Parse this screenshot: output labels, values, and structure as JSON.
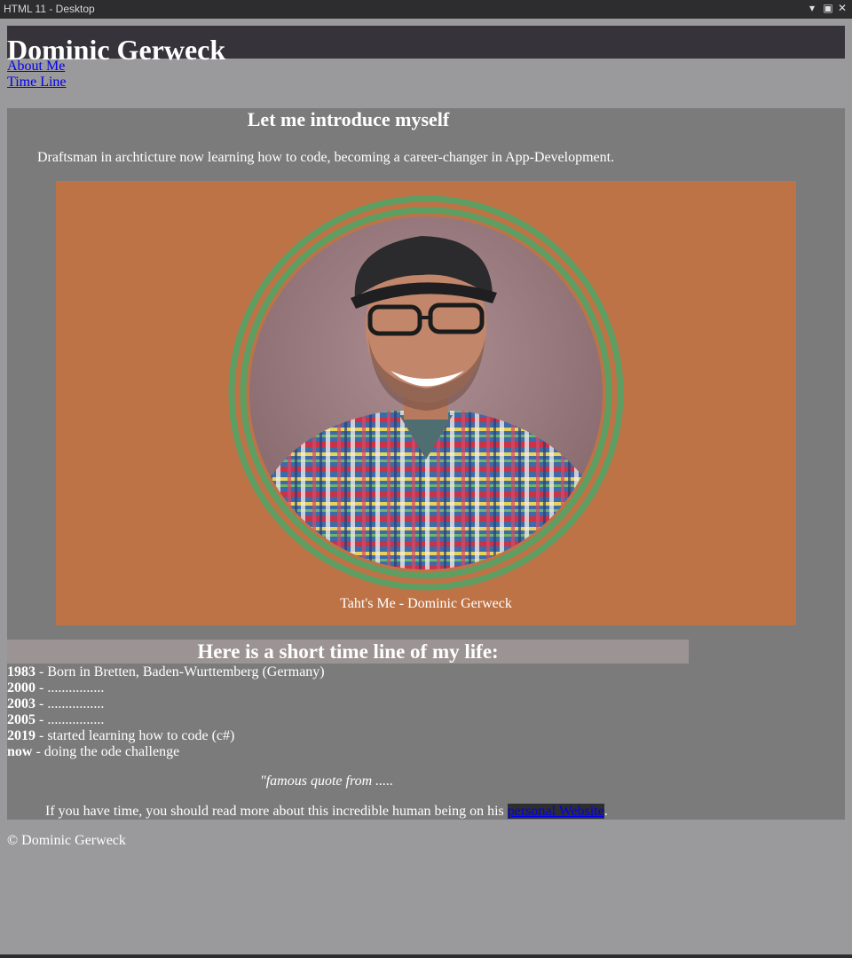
{
  "window": {
    "title": "HTML 11 - Desktop",
    "controls": [
      "dropdown-icon",
      "maximize-icon",
      "close-icon"
    ]
  },
  "header": {
    "title": "Dominic Gerweck"
  },
  "nav": {
    "about": "About Me",
    "timeline": "Time Line"
  },
  "intro": {
    "heading": "Let me introduce myself",
    "text": "Draftsman in archticture now learning how to code, becoming a career-changer in App-Development.",
    "caption": "Taht's Me - Dominic Gerweck"
  },
  "timeline": {
    "heading": "Here is a short time line of my life:",
    "items": [
      {
        "year": "1983",
        "text": " - Born in Bretten, Baden-Wurttemberg (Germany)"
      },
      {
        "year": "2000",
        "text": " - ................"
      },
      {
        "year": "2003",
        "text": " - ................"
      },
      {
        "year": "2005",
        "text": " - ................"
      },
      {
        "year": "2019",
        "text": " - started learning how to code (c#)"
      },
      {
        "year": "now",
        "text": " - doing the ode challenge"
      }
    ],
    "quote": "\"famous quote from .....",
    "more_before": "If you have time, you should read more about this incredible human being on his ",
    "more_link": "personal Website",
    "more_after": "."
  },
  "footer": {
    "text": "© Dominic Gerweck"
  },
  "colors": {
    "header_bg": "#37333a",
    "page_bg": "#9a999c",
    "main_bg": "#7b7b7b",
    "figure_bg": "#be7346",
    "ring": "#5e9e62",
    "link": "#0000ee"
  }
}
